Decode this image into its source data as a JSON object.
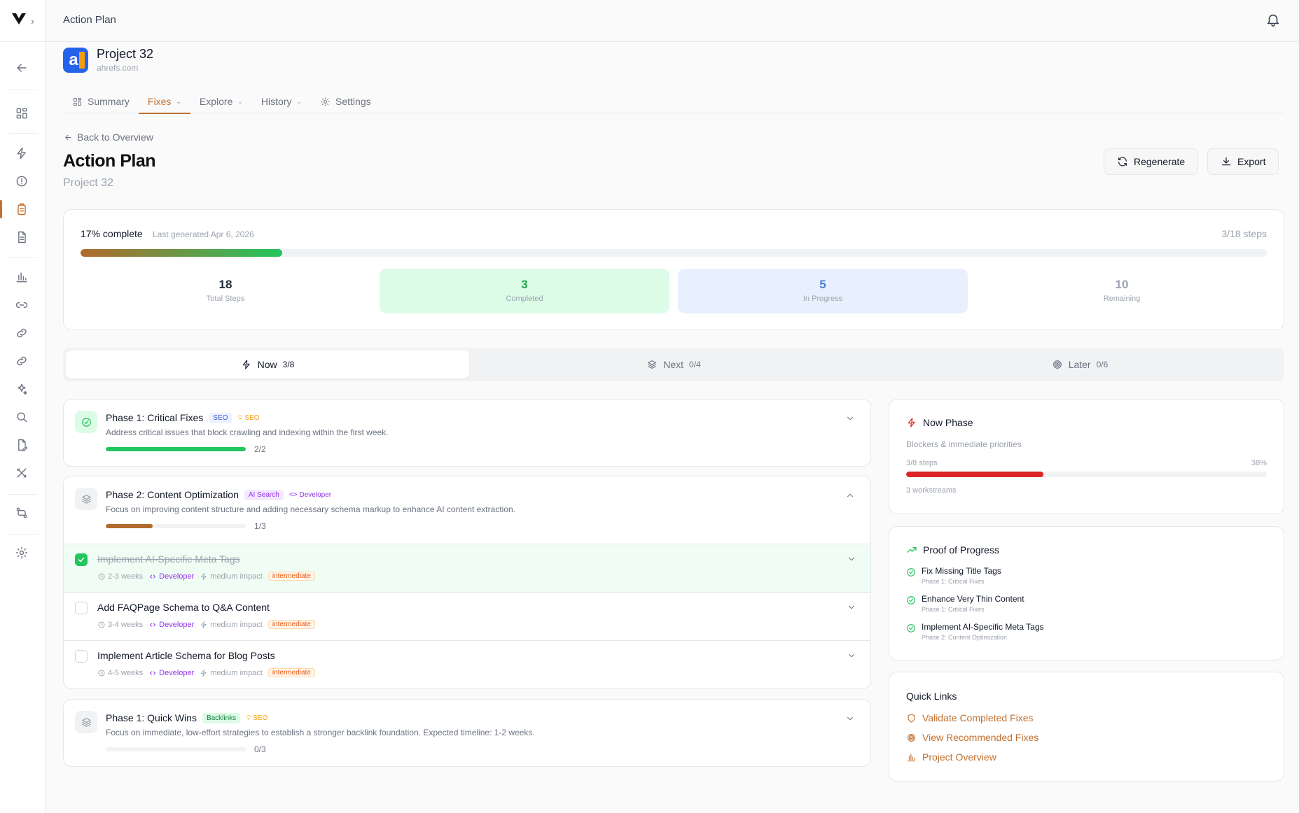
{
  "topbar": {
    "title": "Action Plan"
  },
  "project": {
    "name": "Project 32",
    "domain": "ahrefs.com"
  },
  "tabs": [
    {
      "label": "Summary"
    },
    {
      "label": "Fixes"
    },
    {
      "label": "Explore"
    },
    {
      "label": "History"
    },
    {
      "label": "Settings"
    }
  ],
  "page": {
    "back_label": "Back to Overview",
    "title": "Action Plan",
    "subtitle": "Project 32",
    "regenerate_label": "Regenerate",
    "export_label": "Export"
  },
  "summary": {
    "percent_label": "17% complete",
    "progress": 0.17,
    "last_generated": "Last generated Apr 6, 2026",
    "steps_label": "3/18 steps",
    "stats": [
      {
        "value": "18",
        "label": "Total Steps",
        "color": "#111827"
      },
      {
        "value": "3",
        "label": "Completed",
        "color": "#22a552"
      },
      {
        "value": "5",
        "label": "In Progress",
        "color": "#4a7fd6"
      },
      {
        "value": "10",
        "label": "Remaining",
        "color": "#9ca3af"
      }
    ]
  },
  "phase_tabs": [
    {
      "label": "Now",
      "count": "3/8"
    },
    {
      "label": "Next",
      "count": "0/4"
    },
    {
      "label": "Later",
      "count": "0/6"
    }
  ],
  "phases": [
    {
      "title": "Phase 1: Critical Fixes",
      "badge": "SEO",
      "tag": "SEO",
      "description": "Address critical issues that block crawling and indexing within the first week.",
      "progress": 1.0,
      "count": "2/2"
    },
    {
      "title": "Phase 2: Content Optimization",
      "badge": "AI Search",
      "tag": "Developer",
      "description": "Focus on improving content structure and adding necessary schema markup to enhance AI content extraction.",
      "progress": 0.333,
      "count": "1/3",
      "tasks": [
        {
          "title": "Implement AI-Specific Meta Tags",
          "duration": "2-3 weeks",
          "owner": "Developer",
          "impact": "medium impact",
          "level": "intermediate",
          "done": true
        },
        {
          "title": "Add FAQPage Schema to Q&A Content",
          "duration": "3-4 weeks",
          "owner": "Developer",
          "impact": "medium impact",
          "level": "intermediate",
          "done": false
        },
        {
          "title": "Implement Article Schema for Blog Posts",
          "duration": "4-5 weeks",
          "owner": "Developer",
          "impact": "medium impact",
          "level": "intermediate",
          "done": false
        }
      ]
    },
    {
      "title": "Phase 1: Quick Wins",
      "badge": "Backlinks",
      "tag": "SEO",
      "description": "Focus on immediate, low-effort strategies to establish a stronger backlink foundation. Expected timeline: 1-2 weeks.",
      "progress": 0,
      "count": "0/3"
    }
  ],
  "now_phase": {
    "title": "Now Phase",
    "description": "Blockers & immediate priorities",
    "steps": "3/8 steps",
    "percent": "38%",
    "progress": 0.38,
    "workstreams": "3 workstreams"
  },
  "proof": {
    "title": "Proof of Progress",
    "items": [
      {
        "title": "Fix Missing Title Tags",
        "phase": "Phase 1: Critical Fixes"
      },
      {
        "title": "Enhance Very Thin Content",
        "phase": "Phase 1: Critical Fixes"
      },
      {
        "title": "Implement AI-Specific Meta Tags",
        "phase": "Phase 2: Content Optimization"
      }
    ]
  },
  "quick_links": {
    "title": "Quick Links",
    "items": [
      {
        "label": "Validate Completed Fixes",
        "icon": "shield-icon"
      },
      {
        "label": "View Recommended Fixes",
        "icon": "target-icon"
      },
      {
        "label": "Project Overview",
        "icon": "bar-chart-icon"
      }
    ]
  },
  "colors": {
    "accent": "#c2702f",
    "success": "#22c55e",
    "danger": "#dc2626",
    "info": "#4a7fd6"
  }
}
